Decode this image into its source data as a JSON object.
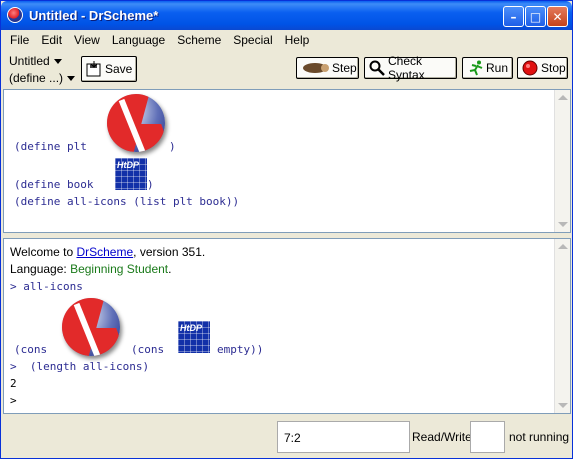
{
  "window": {
    "title": "Untitled - DrScheme*"
  },
  "menu": [
    "File",
    "Edit",
    "View",
    "Language",
    "Scheme",
    "Special",
    "Help"
  ],
  "toolbar": {
    "file_name": "Untitled",
    "define_menu": "(define ...)",
    "save_label": "Save",
    "step_label": "Step",
    "check_syntax_label": "Check Syntax",
    "run_label": "Run",
    "stop_label": "Stop"
  },
  "definitions": {
    "line1_pre": "(define plt ",
    "line1_post": ")",
    "line2_pre": "(define book ",
    "line2_post": ")",
    "line3": "(define all-icons (list plt book))"
  },
  "interactions": {
    "welcome_pre": "Welcome to ",
    "welcome_link": "DrScheme",
    "welcome_post": ", version 351.",
    "language_pre": "Language: ",
    "language_value": "Beginning Student",
    "language_post": ".",
    "prompt1": "> all-icons",
    "cons1": "(cons ",
    "cons2": "(cons ",
    "empty": "empty))",
    "prompt2": ">  (length all-icons)",
    "result": "2",
    "prompt3": ">"
  },
  "icons": {
    "logo": "plt-logo",
    "book": "htdp-logo"
  },
  "status": {
    "position": "7:2",
    "mode": "Read/Write",
    "state": "not running"
  },
  "colors": {
    "code": "#2c2c92",
    "link": "#0000cc",
    "language": "#1a7a1a",
    "titlebar": "#0a5ff0"
  }
}
